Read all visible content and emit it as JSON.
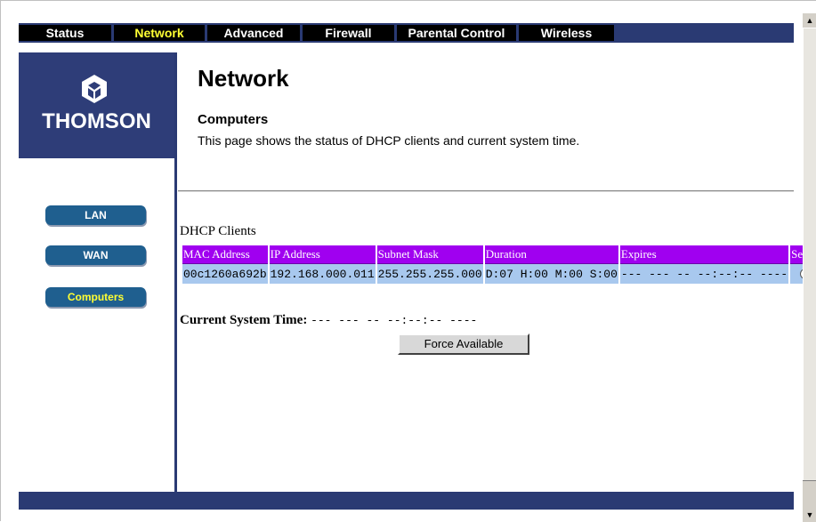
{
  "nav": {
    "tabs": [
      {
        "label": "Status"
      },
      {
        "label": "Network"
      },
      {
        "label": "Advanced"
      },
      {
        "label": "Firewall"
      },
      {
        "label": "Parental Control"
      },
      {
        "label": "Wireless"
      }
    ],
    "active_tab": "Network"
  },
  "brand": {
    "name": "THOMSON",
    "logo_icon": "thomson-logo-icon"
  },
  "sidebar": {
    "items": [
      {
        "label": "LAN"
      },
      {
        "label": "WAN"
      },
      {
        "label": "Computers"
      }
    ],
    "active_item": "Computers"
  },
  "page": {
    "title": "Network",
    "section_title": "Computers",
    "description": "This page shows the status of DHCP clients and current system time."
  },
  "dhcp": {
    "label": "DHCP Clients",
    "columns": [
      "MAC Address",
      "IP Address",
      "Subnet Mask",
      "Duration",
      "Expires",
      "Select"
    ],
    "rows": [
      {
        "mac": "00c1260a692b",
        "ip": "192.168.000.011",
        "subnet": "255.255.255.000",
        "duration": "D:07 H:00 M:00 S:00",
        "expires": "--- --- -- --:--:-- ----"
      }
    ]
  },
  "system_time": {
    "label": "Current System Time:",
    "value": "--- --- -- --:--:-- ----"
  },
  "buttons": {
    "force_available": "Force Available"
  },
  "colors": {
    "nav_bg": "#2a3a73",
    "active_text": "#ffff33",
    "table_header": "#a000f0",
    "table_row": "#a8c8ee",
    "sidebar_button": "#1f5f8f"
  }
}
